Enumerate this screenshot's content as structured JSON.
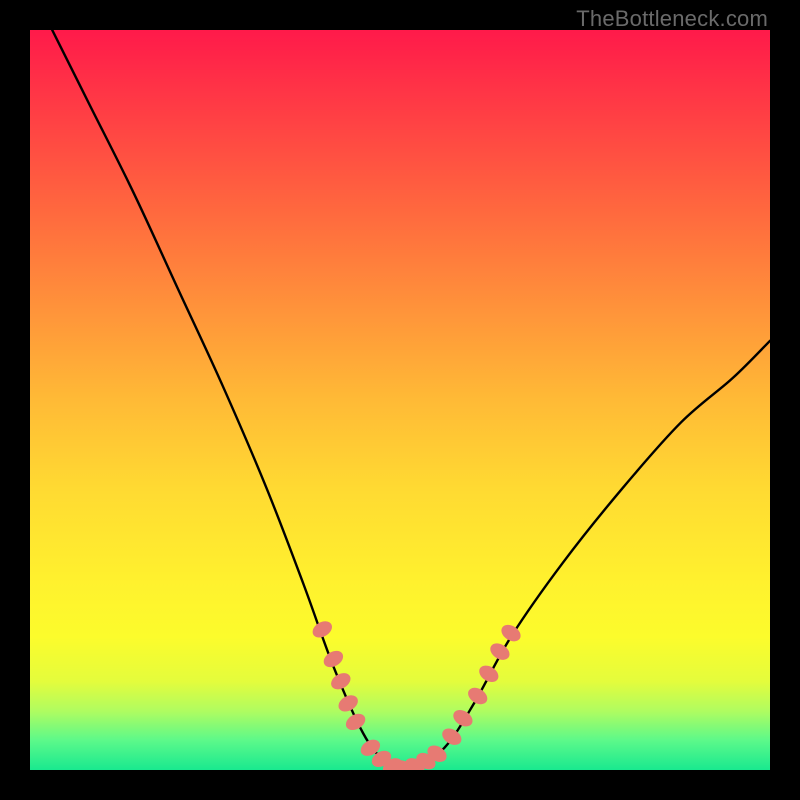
{
  "watermark": "TheBottleneck.com",
  "colors": {
    "background": "#000000",
    "curve": "#000000",
    "marker_fill": "#e77a73",
    "gradient_top": "#ff1a4a",
    "gradient_bottom": "#19e98f"
  },
  "chart_data": {
    "type": "line",
    "title": "",
    "xlabel": "",
    "ylabel": "",
    "xlim": [
      0,
      100
    ],
    "ylim": [
      0,
      100
    ],
    "grid": false,
    "legend": false,
    "curve_note": "V-shaped bottleneck curve; y approximately proportional to deviation from optimal x near 50; minimum at y≈0 around x≈48-52; left branch starts near (3,100) and descends to the valley; right branch rises more gently, reaching about (100,58).",
    "curve_points": [
      {
        "x": 3,
        "y": 100
      },
      {
        "x": 8,
        "y": 90
      },
      {
        "x": 14,
        "y": 78
      },
      {
        "x": 20,
        "y": 65
      },
      {
        "x": 26,
        "y": 52
      },
      {
        "x": 32,
        "y": 38
      },
      {
        "x": 37,
        "y": 25
      },
      {
        "x": 41,
        "y": 14
      },
      {
        "x": 45,
        "y": 5
      },
      {
        "x": 48,
        "y": 1
      },
      {
        "x": 50,
        "y": 0
      },
      {
        "x": 52,
        "y": 0.5
      },
      {
        "x": 56,
        "y": 3
      },
      {
        "x": 60,
        "y": 9
      },
      {
        "x": 65,
        "y": 18
      },
      {
        "x": 72,
        "y": 28
      },
      {
        "x": 80,
        "y": 38
      },
      {
        "x": 88,
        "y": 47
      },
      {
        "x": 95,
        "y": 53
      },
      {
        "x": 100,
        "y": 58
      }
    ],
    "markers_note": "Pink rounded markers clustered near the valley floor along both branches.",
    "marker_points": [
      {
        "x": 39.5,
        "y": 19
      },
      {
        "x": 41.0,
        "y": 15
      },
      {
        "x": 42.0,
        "y": 12
      },
      {
        "x": 43.0,
        "y": 9
      },
      {
        "x": 44.0,
        "y": 6.5
      },
      {
        "x": 46.0,
        "y": 3
      },
      {
        "x": 47.5,
        "y": 1.5
      },
      {
        "x": 49.0,
        "y": 0.5
      },
      {
        "x": 50.5,
        "y": 0.2
      },
      {
        "x": 52.0,
        "y": 0.5
      },
      {
        "x": 53.5,
        "y": 1.2
      },
      {
        "x": 55.0,
        "y": 2.2
      },
      {
        "x": 57.0,
        "y": 4.5
      },
      {
        "x": 58.5,
        "y": 7
      },
      {
        "x": 60.5,
        "y": 10
      },
      {
        "x": 62.0,
        "y": 13
      },
      {
        "x": 63.5,
        "y": 16
      },
      {
        "x": 65.0,
        "y": 18.5
      }
    ]
  }
}
